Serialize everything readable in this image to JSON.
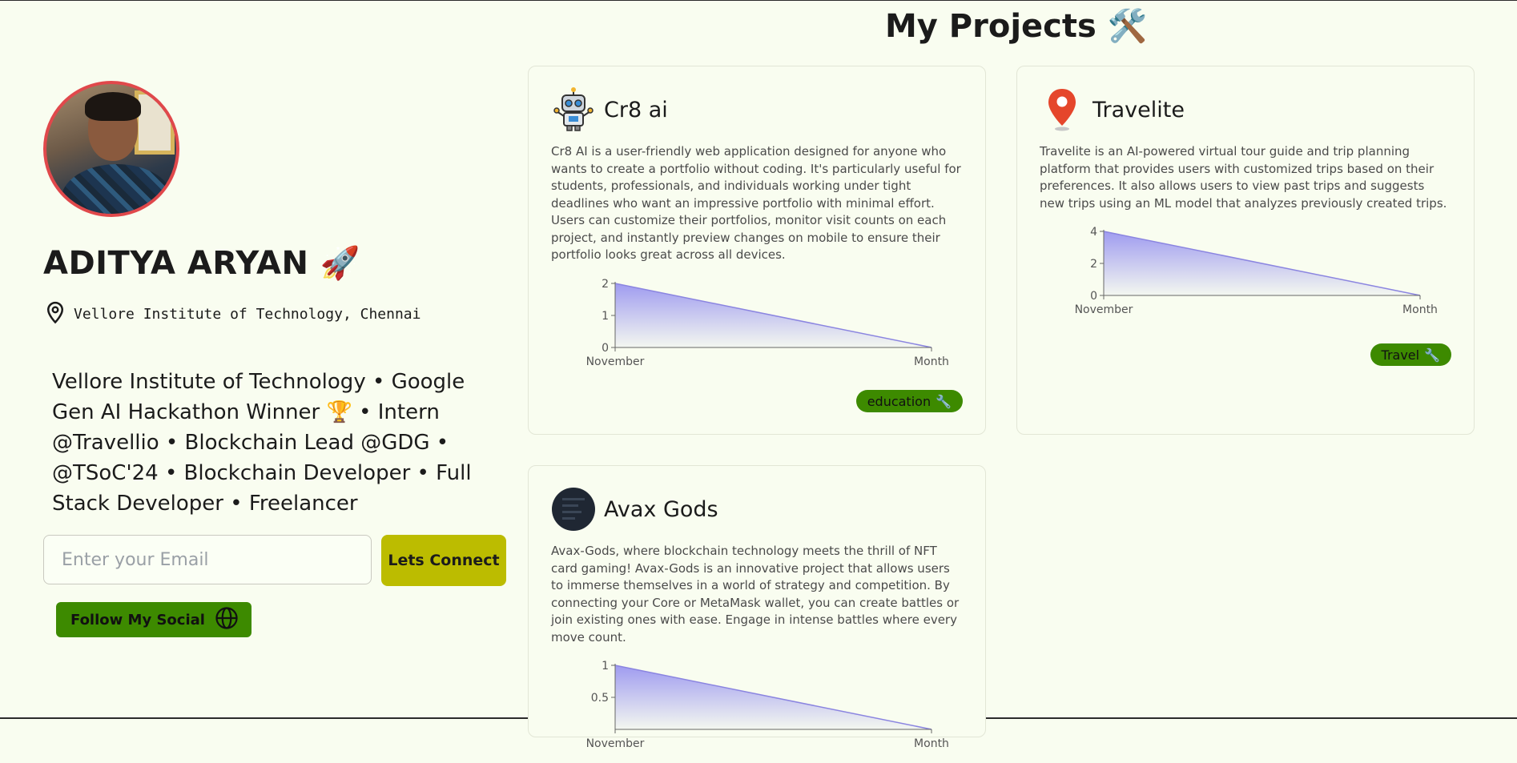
{
  "profile": {
    "name": "ADITYA ARYAN",
    "name_emoji": "🚀",
    "location": "Vellore Institute of Technology, Chennai",
    "bio": "Vellore Institute of Technology • Google Gen AI Hackathon Winner 🏆 • Intern @Travellio • Blockchain Lead @GDG • @TSoC'24 • Blockchain Developer • Full Stack Developer • Freelancer",
    "email_placeholder": "Enter your Email",
    "connect_label": "Lets Connect",
    "follow_label": "Follow My Social",
    "follow_icon": "globe-icon"
  },
  "projects_section": {
    "title": "My Projects",
    "title_emoji": "🛠️"
  },
  "colors": {
    "background": "#f9fdf0",
    "accent_green": "#3d8a00",
    "connect_yellow": "#bcbc00",
    "avatar_border": "#e0484b",
    "chart_line": "#8b85e0",
    "chart_fill": "#8f8af0"
  },
  "projects": [
    {
      "title": "Cr8 ai",
      "icon": "robot-icon",
      "description": "Cr8 AI is a user-friendly web application designed for anyone who wants to create a portfolio without coding. It's particularly useful for students, professionals, and individuals working under tight deadlines who want an impressive portfolio with minimal effort. Users can customize their portfolios, monitor visit counts on each project, and instantly preview changes on mobile to ensure their portfolio looks great across all devices.",
      "tag": "education",
      "tag_icon": "🔧",
      "chart_data": {
        "type": "area",
        "x": [
          "November",
          "Month"
        ],
        "values": [
          2,
          0
        ],
        "yticks": [
          "0",
          "1",
          "2"
        ],
        "ylim": [
          0,
          2
        ]
      }
    },
    {
      "title": "Travelite",
      "icon": "map-pin-icon",
      "description": "Travelite is an AI-powered virtual tour guide and trip planning platform that provides users with customized trips based on their preferences. It also allows users to view past trips and suggests new trips using an ML model that analyzes previously created trips.",
      "tag": "Travel",
      "tag_icon": "🔧",
      "chart_data": {
        "type": "area",
        "x": [
          "November",
          "Month"
        ],
        "values": [
          4,
          0
        ],
        "yticks": [
          "0",
          "2",
          "4"
        ],
        "ylim": [
          0,
          4
        ]
      }
    },
    {
      "title": "Avax Gods",
      "icon": "avatar-icon",
      "description": "Avax-Gods, where blockchain technology meets the thrill of NFT card gaming! Avax-Gods is an innovative project that allows users to immerse themselves in a world of strategy and competition. By connecting your Core or MetaMask wallet, you can create battles or join existing ones with ease. Engage in intense battles where every move count.",
      "chart_data": {
        "type": "area",
        "x": [
          "November",
          "Month"
        ],
        "values": [
          1,
          0
        ],
        "yticks": [
          "0.5",
          "1"
        ],
        "ylim": [
          0,
          1
        ]
      }
    }
  ]
}
